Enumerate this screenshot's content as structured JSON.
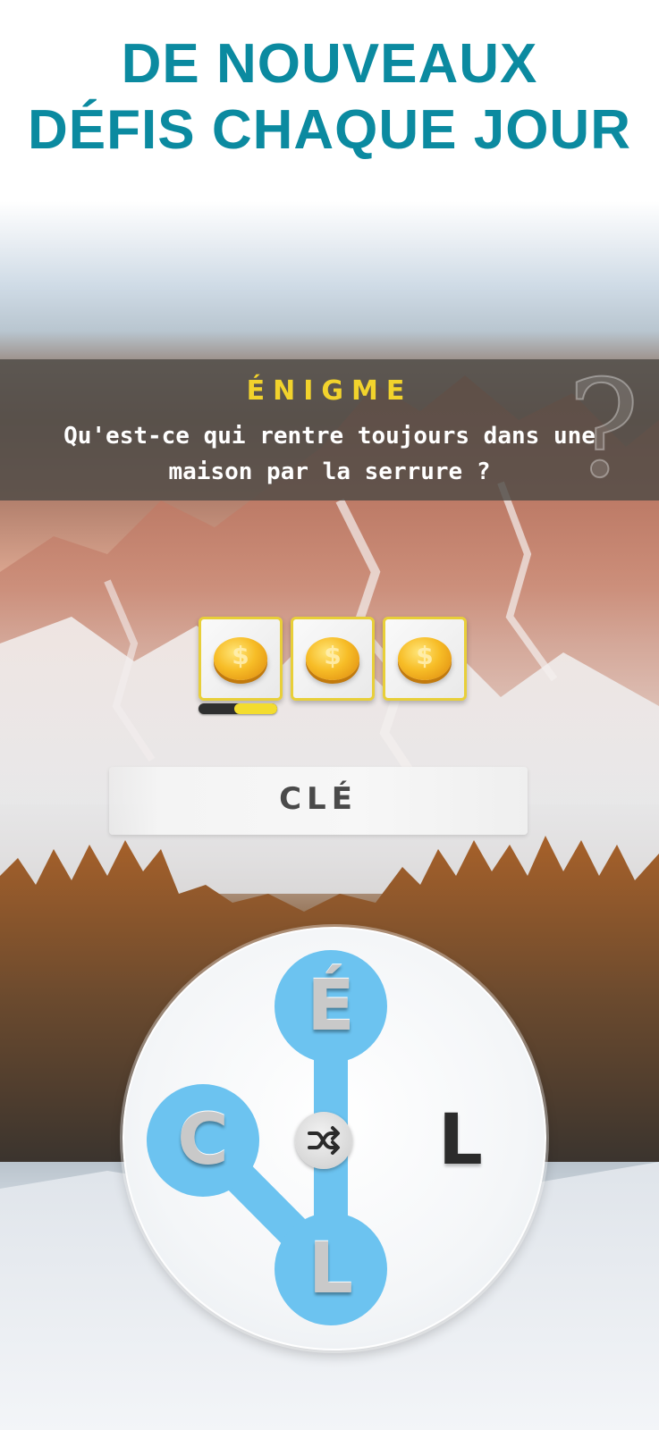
{
  "headline": {
    "line1": "DE NOUVEAUX",
    "line2": "DÉFIS CHAQUE JOUR"
  },
  "riddle": {
    "title": "ÉNIGME",
    "question": "Qu'est-ce qui rentre toujours dans une maison par la serrure ?"
  },
  "hints": {
    "tiles": [
      {
        "icon": "coin-icon"
      },
      {
        "icon": "coin-icon"
      },
      {
        "icon": "coin-icon"
      }
    ],
    "progress": 0.55
  },
  "answer": "CLÉ",
  "wheel": {
    "letters": [
      "É",
      "C",
      "L",
      "L"
    ],
    "selected_letters": [
      "É",
      "C",
      "L"
    ],
    "shuffle_icon": "shuffle-icon"
  },
  "colors": {
    "headline": "#0b8aa0",
    "riddle_title": "#f2d32c",
    "selection": "#6cc3f0",
    "tile_border": "#e8cf39"
  }
}
